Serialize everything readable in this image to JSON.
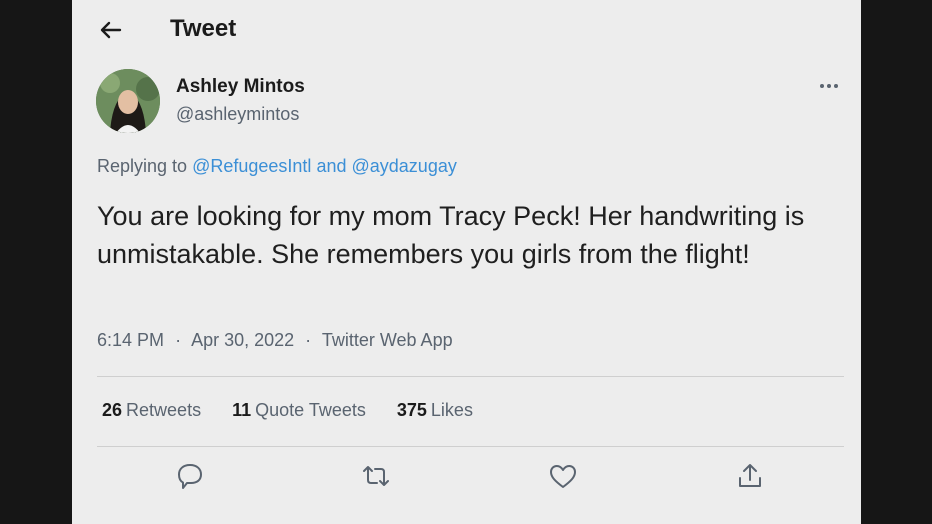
{
  "header": {
    "title": "Tweet"
  },
  "author": {
    "name": "Ashley Mintos",
    "handle": "@ashleymintos"
  },
  "reply": {
    "prefix": "Replying to",
    "mention1": "@RefugeesIntl",
    "conjunction": "and",
    "mention2": "@aydazugay"
  },
  "tweet": {
    "text": "You are looking for my mom Tracy Peck! Her handwriting is unmistakable. She remembers you girls from the flight!",
    "time": "6:14 PM",
    "date": "Apr 30, 2022",
    "source": "Twitter Web App",
    "separator": "·"
  },
  "stats": {
    "retweets_count": "26",
    "retweets_label": "Retweets",
    "quotes_count": "11",
    "quotes_label": "Quote Tweets",
    "likes_count": "375",
    "likes_label": "Likes"
  },
  "actions": [
    "reply-icon",
    "retweet-icon",
    "like-icon",
    "share-icon"
  ],
  "colors": {
    "accent": "#3b8fd6",
    "background": "#ededed",
    "muted": "#5a6470"
  }
}
